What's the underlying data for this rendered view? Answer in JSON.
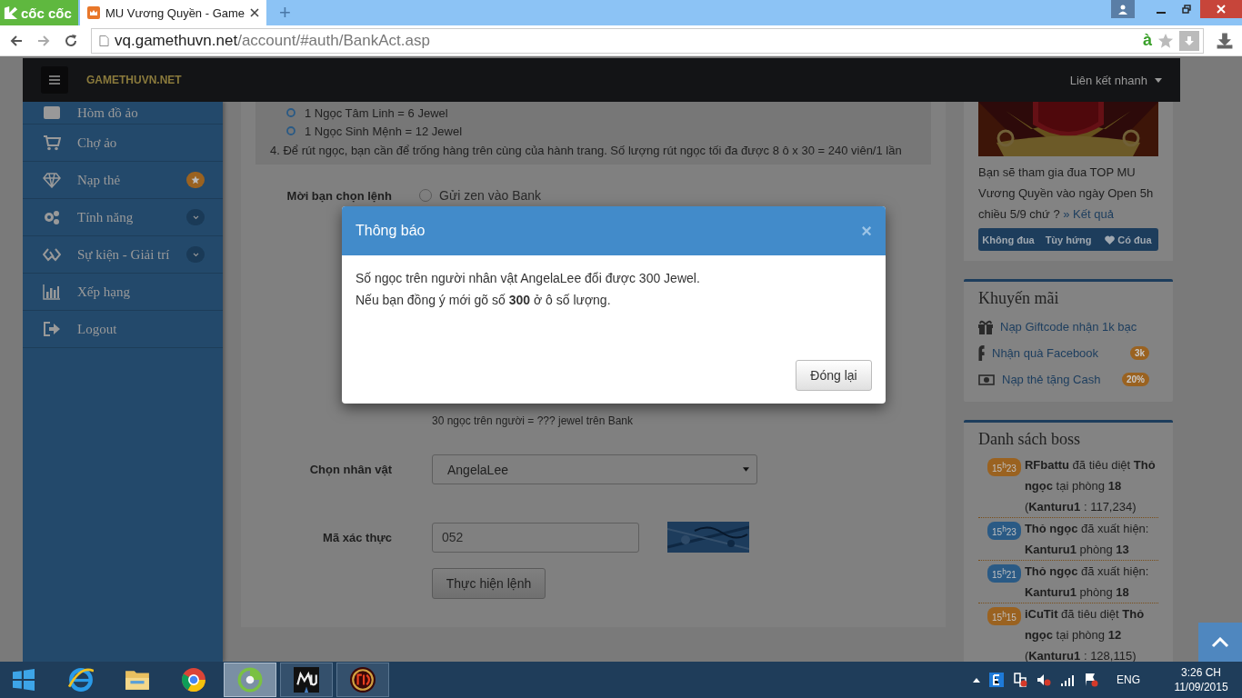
{
  "browser": {
    "brand": "cốc cốc",
    "tabs": [
      {
        "title": "MU Vương Quyền - Game",
        "selected": true
      }
    ],
    "new_tab": "+",
    "url_host": "vq.gamethuvn.net",
    "url_path": "/account/#auth/BankAct.asp",
    "addon_glyph": "à"
  },
  "header": {
    "logo": "GAMETHUVN.NET",
    "quick_links": "Liên kết nhanh"
  },
  "sidebar": {
    "items": [
      {
        "label": "Hòm đồ ảo",
        "starred": false,
        "expandable": false
      },
      {
        "label": "Chợ ảo",
        "starred": false,
        "expandable": false
      },
      {
        "label": "Nạp thẻ",
        "starred": true,
        "expandable": false
      },
      {
        "label": "Tính năng",
        "starred": false,
        "expandable": true
      },
      {
        "label": "Sự kiện - Giải trí",
        "starred": false,
        "expandable": true
      },
      {
        "label": "Xếp hạng",
        "starred": false,
        "expandable": false
      },
      {
        "label": "Logout",
        "starred": false,
        "expandable": false
      }
    ]
  },
  "info": {
    "rates": [
      "1 Ngọc Tâm Linh = 6 Jewel",
      "1 Ngọc Sinh Mệnh = 12 Jewel"
    ],
    "note": "4. Để rút ngọc, bạn cần để trống hàng trên cùng của hành trang. Số lượng rút ngọc tối đa được 8 ô x 30 = 240 viên/1 lần"
  },
  "form": {
    "command_label": "Mời bạn chọn lệnh",
    "options": [
      {
        "label": "Gửi zen vào Bank",
        "selected": false
      }
    ],
    "hint": "30 ngọc trên người = ??? jewel trên Bank",
    "character": {
      "label": "Chọn nhân vật",
      "value": "AngelaLee"
    },
    "captcha": {
      "label": "Mã xác thực",
      "value": "052"
    },
    "submit": "Thực hiện lệnh"
  },
  "promo": {
    "text": "Bạn sẽ tham gia đua TOP MU Vương Quyền vào ngày Open 5h chiều 5/9 chứ ?",
    "link": "» Kết quả",
    "votes": [
      {
        "label": "Không đua",
        "has_icon": false
      },
      {
        "label": "Tùy hứng",
        "has_icon": false
      },
      {
        "label": "Có đua",
        "has_icon": true
      }
    ]
  },
  "offers": {
    "title": "Khuyến mãi",
    "items": [
      {
        "label": "Nạp Giftcode nhận 1k bạc"
      },
      {
        "label": "Nhận quà Facebook",
        "badge": "3k"
      },
      {
        "label": "Nạp thẻ tặng Cash",
        "badge": "20%"
      }
    ]
  },
  "bosses": {
    "title": "Danh sách boss",
    "entries": [
      {
        "time": "15$^{h}$23",
        "color": "#9a6220",
        "text": "**RFbattu** đã tiêu diệt **Thỏ ngọc** tại phòng **18** (**Kanturu1** : 117,234)"
      },
      {
        "time": "15$^{h}$23",
        "color": "#2a5a85",
        "text": "**Thỏ ngọc** đã xuất hiện: **Kanturu1** phòng **13**"
      },
      {
        "time": "15$^{h}$21",
        "color": "#2a5a85",
        "text": "**Thỏ ngọc** đã xuất hiện: **Kanturu1** phòng **18**"
      },
      {
        "time": "15$^{h}$15",
        "color": "#9a6220",
        "text": "**iCuTit** đã tiêu diệt **Thỏ ngọc** tại phòng **12** (**Kanturu1** : 128,115)"
      }
    ]
  },
  "modal": {
    "title": "Thông báo",
    "close": "×",
    "lines": [
      "Số ngọc trên người nhân vật AngelaLee đổi được 300 Jewel.",
      "Nếu bạn đồng ý mới gõ số **300** ở ô số lượng."
    ],
    "button": "Đóng lại"
  },
  "taskbar": {
    "apps": [
      {
        "selected": false,
        "running": false
      },
      {
        "selected": false,
        "running": false
      },
      {
        "selected": false,
        "running": false
      },
      {
        "selected": true,
        "running": true
      },
      {
        "selected": false,
        "running": true
      },
      {
        "selected": false,
        "running": true
      }
    ],
    "language": "ENG",
    "time": "3:26 CH",
    "date": "11/09/2015"
  }
}
